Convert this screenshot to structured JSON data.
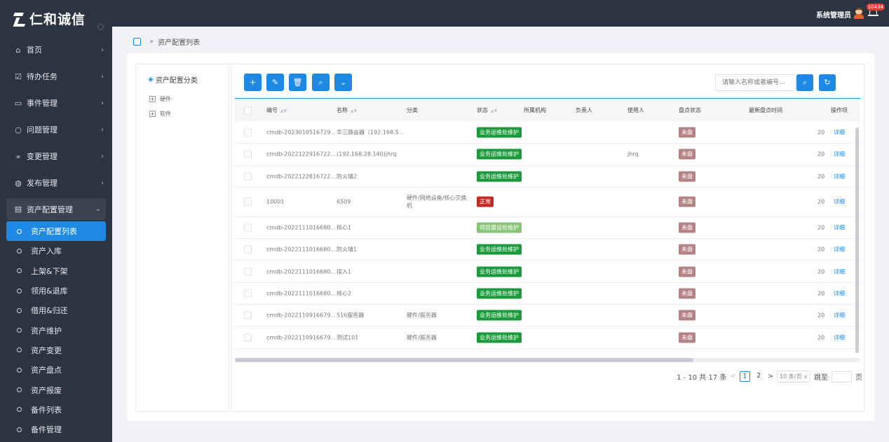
{
  "brand": {
    "name": "仁和诚信"
  },
  "header": {
    "user_name": "系统管理员",
    "notification_count": "10434"
  },
  "breadcrumb": {
    "current": "资产配置列表"
  },
  "sidebar": {
    "items": [
      {
        "label": "首页",
        "icon": "home-icon"
      },
      {
        "label": "待办任务",
        "icon": "checklist-icon"
      },
      {
        "label": "事件管理",
        "icon": "monitor-icon"
      },
      {
        "label": "问题管理",
        "icon": "chat-icon"
      },
      {
        "label": "变更管理",
        "icon": "fast-forward-icon"
      },
      {
        "label": "发布管理",
        "icon": "globe-icon"
      }
    ],
    "group": {
      "label": "资产配置管理",
      "icon": "storage-icon"
    },
    "sub_items": [
      "资产配置列表",
      "资产入库",
      "上架&下架",
      "领用&退库",
      "借用&归还",
      "资产维护",
      "资产变更",
      "资产盘点",
      "资产报废",
      "备件列表",
      "备件管理"
    ]
  },
  "tree": {
    "title": "资产配置分类",
    "nodes": [
      "硬件",
      "软件"
    ]
  },
  "toolbar": {
    "buttons": [
      "+",
      "✎",
      "🗑",
      "⌕",
      "⌄"
    ],
    "search_placeholder": "请输入名称或者编号..."
  },
  "table": {
    "headers": {
      "code": "编号",
      "name": "名称",
      "category": "分类",
      "status": "状态",
      "org": "所属机构",
      "owner": "负责人",
      "user": "使用人",
      "check_status": "盘点状态",
      "last_check": "最新盘点时间",
      "ops": "操作项"
    },
    "rows": [
      {
        "code": "cmdb-2023010516729...",
        "name": "华三路由器（192.168.5...",
        "category": "",
        "status": "业务运维处维护",
        "status_color": "green",
        "user": "",
        "check": "未盘",
        "date": "20",
        "op": "详细"
      },
      {
        "code": "cmdb-2022122916722...",
        "name": "(192.168.28.140)jhrq",
        "category": "",
        "status": "业务运维处维护",
        "status_color": "green",
        "user": "jhrq",
        "check": "未盘",
        "date": "20",
        "op": "详细"
      },
      {
        "code": "cmdb-2022122816722...",
        "name": "防火墙2",
        "category": "",
        "status": "业务运维处维护",
        "status_color": "green",
        "user": "",
        "check": "未盘",
        "date": "20",
        "op": "详细"
      },
      {
        "code": "10001",
        "name": "6509",
        "category": "硬件/网络设备/核心交换机",
        "status": "正常",
        "status_color": "red",
        "user": "",
        "check": "未盘",
        "date": "20",
        "op": "详细"
      },
      {
        "code": "cmdb-2022111016680...",
        "name": "核心1",
        "category": "",
        "status": "项目建设处维护",
        "status_color": "lightgreen",
        "user": "",
        "check": "未盘",
        "date": "20",
        "op": "详细"
      },
      {
        "code": "cmdb-2022111016680...",
        "name": "防火墙1",
        "category": "",
        "status": "业务运维处维护",
        "status_color": "green",
        "user": "",
        "check": "未盘",
        "date": "20",
        "op": "详细"
      },
      {
        "code": "cmdb-2022111016680...",
        "name": "接入1",
        "category": "",
        "status": "业务运维处维护",
        "status_color": "green",
        "user": "",
        "check": "未盘",
        "date": "20",
        "op": "详细"
      },
      {
        "code": "cmdb-2022111016680...",
        "name": "核心2",
        "category": "",
        "status": "业务运维处维护",
        "status_color": "green",
        "user": "",
        "check": "未盘",
        "date": "20",
        "op": "详细"
      },
      {
        "code": "cmdb-2022110916679...",
        "name": "516服务器",
        "category": "硬件/服务器",
        "status": "业务运维处维护",
        "status_color": "green",
        "user": "",
        "check": "未盘",
        "date": "20",
        "op": "详细"
      },
      {
        "code": "cmdb-2022110916679...",
        "name": "测试101",
        "category": "硬件/服务器",
        "status": "业务运维处维护",
        "status_color": "green",
        "user": "",
        "check": "未盘",
        "date": "20",
        "op": "详细"
      }
    ]
  },
  "pagination": {
    "summary": "1 - 10 共 17 条",
    "prev": "<",
    "pages": [
      "1",
      "2"
    ],
    "next": ">",
    "page_size": "10 条/页",
    "jump_label": "跳至",
    "jump_unit": "页"
  },
  "colors": {
    "accent": "#1e88e5",
    "sidebar_bg": "#2b3440",
    "tag_green": "#1a9a3a",
    "tag_red": "#c62828",
    "tag_mauve": "#b48484"
  }
}
